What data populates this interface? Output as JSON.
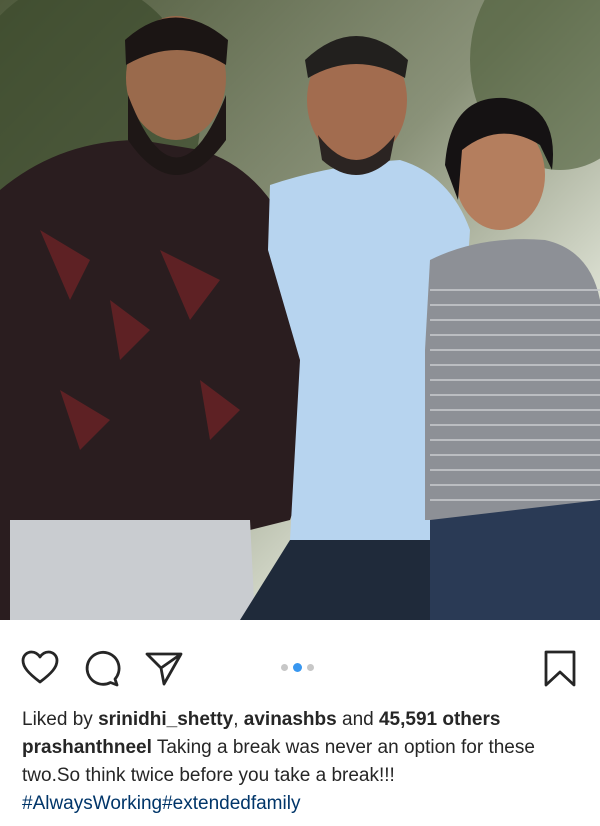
{
  "post": {
    "image_alt_description_icon": "group-photo-image",
    "carousel": {
      "count": 3,
      "active_index": 1
    },
    "actions": {
      "like_icon": "heart-icon",
      "comment_icon": "comment-icon",
      "share_icon": "send-icon",
      "save_icon": "bookmark-icon"
    },
    "likes": {
      "prefix": "Liked by",
      "user1": "srinidhi_shetty",
      "separator": ",",
      "user2": "avinashbs",
      "conjunction": "and",
      "others": "45,591 others"
    },
    "caption": {
      "author": "prashanthneel",
      "text": "Taking a break was never an option for these two.So think twice before you take a break!!!"
    },
    "hashtags": [
      "#AlwaysWorking",
      "#extendedfamily"
    ]
  },
  "colors": {
    "accent_dot": "#3897f0",
    "hashtag": "#003569",
    "text": "#262626"
  }
}
